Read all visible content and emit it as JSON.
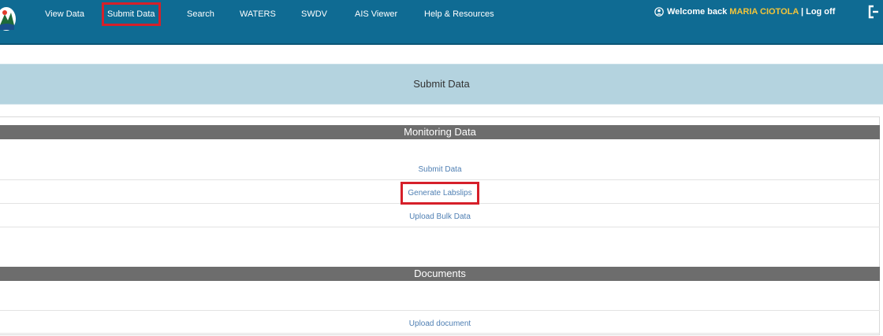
{
  "nav": {
    "items": [
      {
        "label": "View Data"
      },
      {
        "label": "Submit Data"
      },
      {
        "label": "Search"
      },
      {
        "label": "WATERS"
      },
      {
        "label": "SWDV"
      },
      {
        "label": "AIS Viewer"
      },
      {
        "label": "Help & Resources"
      }
    ],
    "active_item": "Submit Data",
    "welcome_prefix": "Welcome back",
    "username": "MARIA CIOTOLA",
    "separator": "|",
    "logoff_label": "Log off"
  },
  "page": {
    "title": "Submit Data"
  },
  "sections": {
    "monitoring": {
      "title": "Monitoring Data",
      "links": [
        "Submit Data",
        "Generate Labslips",
        "Upload Bulk Data"
      ]
    },
    "documents": {
      "title": "Documents",
      "links": [
        "Upload document"
      ]
    }
  },
  "colors": {
    "navbar": "#0f6b93",
    "header_band": "#b4d3df",
    "section_header": "#6d6d6d",
    "link": "#4f7fb3",
    "highlight": "#d6202a",
    "username": "#f2c43a"
  },
  "icons": {
    "logo": "agency-logo",
    "user": "user-circle-icon",
    "logoff": "logoff-icon"
  }
}
